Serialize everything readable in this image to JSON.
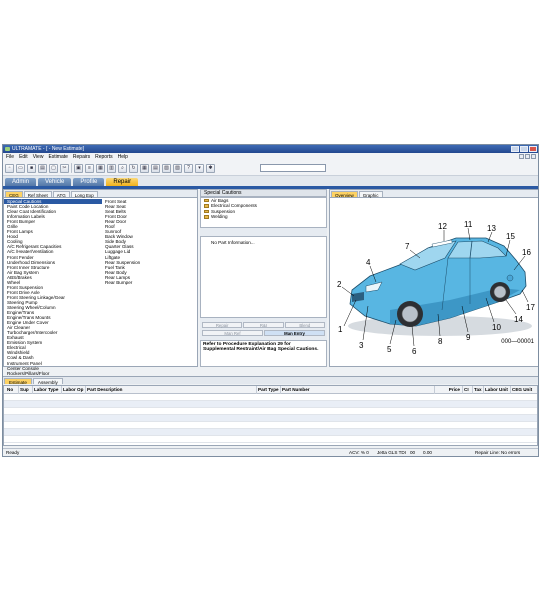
{
  "window": {
    "title": "ULTRAMATE - [ - New Estimate]"
  },
  "menu": [
    "File",
    "Edit",
    "View",
    "Estimate",
    "Repairs",
    "Reports",
    "Help"
  ],
  "nav_tabs": [
    {
      "label": "Admin",
      "active": false
    },
    {
      "label": "Vehicle",
      "active": false
    },
    {
      "label": "Profile",
      "active": false
    },
    {
      "label": "Repair",
      "active": true
    }
  ],
  "left_tabs": [
    {
      "label": "CEG",
      "active": true
    },
    {
      "label": "Ref Sheet",
      "active": false
    },
    {
      "label": "ATG",
      "active": false
    },
    {
      "label": "Long Exp",
      "active": false
    }
  ],
  "categories_col1": [
    "Special Cautions",
    "Paint Code Location",
    "Clear Coat Identification",
    "Information Labels",
    "Front Bumper",
    "Grille",
    "Front Lamps",
    "Hood",
    "Cooling",
    "A/C Refrigerant Capacities",
    "A/C /Heater/Ventilation",
    "Front Fender",
    "Underhood Dimensions",
    "Front Inner Structure",
    "Air Bag System",
    "ABS/Brakes",
    "Wheel",
    "Front Suspension",
    "Front Drive Axle",
    "Front Steering Linkage/Gear",
    "Steering Pump",
    "Steering Wheel/Column",
    "Engine/Trans",
    "Engine/Trans Mounts",
    "Engine Under Cover",
    "Air Cleaner",
    "Turbocharger/Intercooler",
    "Exhaust",
    "Emission System",
    "Electrical",
    "Windshield",
    "Cowl & Dash",
    "Instrument Panel",
    "Center Console",
    "Rockers/Pillars/Floor"
  ],
  "categories_col2": [
    "Front Seat",
    "Rear Seat",
    "Seat Belts",
    "Front Door",
    "Rear Door",
    "Roof",
    "Sunroof",
    "Back Window",
    "Side Body",
    "Quarter Glass",
    "Luggage Lid",
    "Liftgate",
    "Rear Suspension",
    "Fuel Tank",
    "Rear Body",
    "Rear Lamps",
    "Rear Bumper"
  ],
  "middle": {
    "header": "Special Cautions",
    "groups": [
      "Air Bags",
      "Electrical Components",
      "Suspension",
      "Welding"
    ],
    "parts_header": "No Part Information...",
    "buttons1": [
      "Repair",
      "R&I",
      "Blend"
    ],
    "buttons2": [
      "Man Ref",
      "Man Entry"
    ],
    "note": "Refer to Procedure Explanation 29 for Supplemental Restraint/Air Bag Special Cautions."
  },
  "right_tabs": [
    {
      "label": "Overview",
      "active": true
    },
    {
      "label": "Graphic",
      "active": false
    }
  ],
  "diagram": {
    "callouts": [
      "1",
      "2",
      "3",
      "4",
      "5",
      "6",
      "7",
      "8",
      "9",
      "10",
      "11",
      "12",
      "13",
      "14",
      "15",
      "16",
      "17"
    ],
    "code": "000—00001",
    "body_color": "#58b6e2"
  },
  "estimate_tabs": [
    {
      "label": "Estimate",
      "active": true
    },
    {
      "label": "Assembly",
      "active": false
    }
  ],
  "grid_columns": [
    "No",
    "Sup",
    "Labor Type",
    "Labor Op",
    "Part Description",
    "Part Type",
    "Part Number",
    "Price",
    "CI",
    "Tax",
    "Labor Unit",
    "CEG Unit"
  ],
  "status": {
    "left": "Ready",
    "acv": "ACV: % 0",
    "vehicle": "Jetta GLS TDI",
    "n1": "00",
    "n2": "0.00",
    "right": "Repair Line: No errors"
  }
}
